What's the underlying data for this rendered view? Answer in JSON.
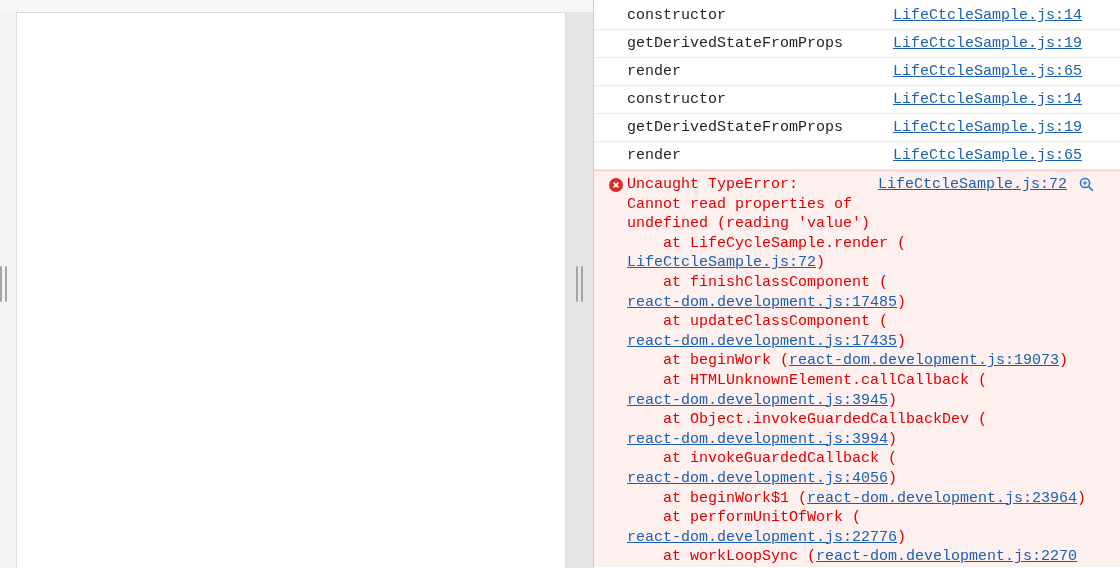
{
  "console": {
    "logs": [
      {
        "message": "constructor",
        "source": "LifeCtcleSample.js:14"
      },
      {
        "message": "getDerivedStateFromProps",
        "source": "LifeCtcleSample.js:19"
      },
      {
        "message": "render",
        "source": "LifeCtcleSample.js:65"
      },
      {
        "message": "constructor",
        "source": "LifeCtcleSample.js:14"
      },
      {
        "message": "getDerivedStateFromProps",
        "source": "LifeCtcleSample.js:19"
      },
      {
        "message": "render",
        "source": "LifeCtcleSample.js:65"
      }
    ],
    "error": {
      "title": "Uncaught TypeError:",
      "message": "Cannot read properties of undefined (reading 'value')",
      "source": "LifeCtcleSample.js:72",
      "stack": [
        {
          "call": "at LifeCycleSample.render (",
          "source": "LifeCtcleSample.js:72",
          "close": ")"
        },
        {
          "call": "at finishClassComponent (",
          "source": "react-dom.development.js:17485",
          "close": ")"
        },
        {
          "call": "at updateClassComponent (",
          "source": "react-dom.development.js:17435",
          "close": ")"
        },
        {
          "call": "at beginWork (",
          "source": "react-dom.development.js:19073",
          "close": ")"
        },
        {
          "call": "at HTMLUnknownElement.callCallback (",
          "source": "react-dom.development.js:3945",
          "close": ")"
        },
        {
          "call": "at Object.invokeGuardedCallbackDev (",
          "source": "react-dom.development.js:3994",
          "close": ")"
        },
        {
          "call": "at invokeGuardedCallback (",
          "source": "react-dom.development.js:4056",
          "close": ")"
        },
        {
          "call": "at beginWork$1 (",
          "source": "react-dom.development.js:23964",
          "close": ")"
        },
        {
          "call": "at performUnitOfWork (",
          "source": "react-dom.development.js:22776",
          "close": ")"
        },
        {
          "call": "at workLoopSync (",
          "source": "react-dom.development.js:2270"
        }
      ]
    }
  }
}
